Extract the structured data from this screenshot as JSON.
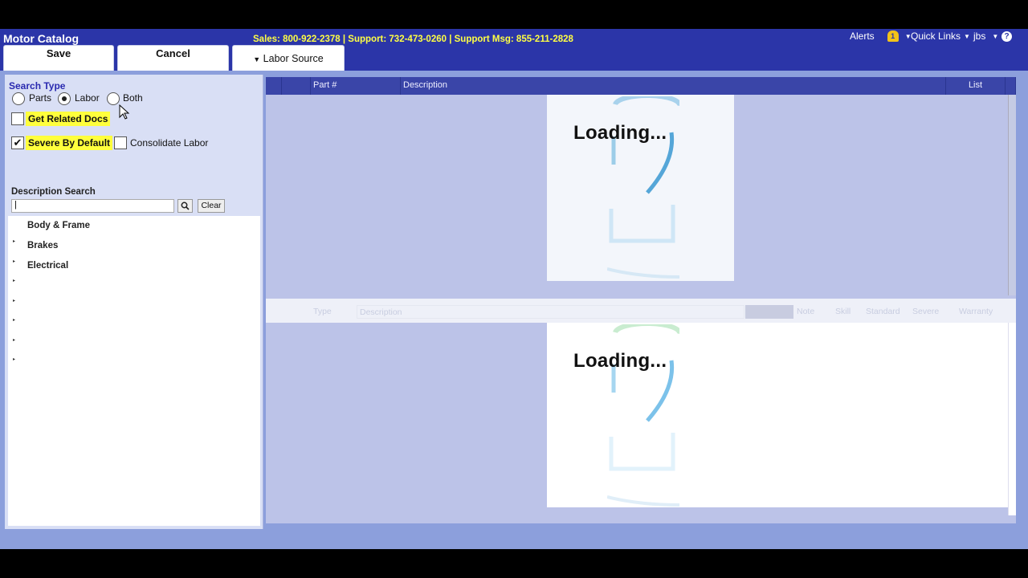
{
  "header": {
    "app_title": "Motor Catalog",
    "support_line": "Sales: 800-922-2378 | Support: 732-473-0260 | Support Msg: 855-211-2828",
    "alerts_label": "Alerts",
    "alerts_count": "1",
    "quick_links_label": "Quick Links",
    "user_label": "jbs",
    "help_label": "?"
  },
  "toolbar": {
    "save_label": "Save",
    "cancel_label": "Cancel",
    "labor_source_label": "Labor Source"
  },
  "search": {
    "type_label": "Search Type",
    "parts_label": "Parts",
    "labor_label": "Labor",
    "both_label": "Both",
    "selected": "Labor",
    "related_docs_label": "Get Related Docs",
    "related_docs_checked": false,
    "severe_label": "Severe By Default",
    "severe_checked": true,
    "consolidate_label": "Consolidate Labor",
    "consolidate_checked": false,
    "description_label": "Description Search",
    "description_value": "|",
    "clear_label": "Clear"
  },
  "tree": {
    "items": [
      "Body & Frame",
      "Brakes",
      "Electrical"
    ]
  },
  "grid": {
    "columns": [
      "Part #",
      "Description",
      "List"
    ],
    "lower_columns": [
      "Type",
      "Description",
      "Note",
      "Skill",
      "Standard",
      "Severe",
      "Warranty"
    ],
    "loading_text": "Loading..."
  },
  "colors": {
    "header_bg": "#2b35a8",
    "support_text": "#ffff44",
    "highlight": "#ffff3c",
    "panel_bg": "#d9dff5"
  }
}
